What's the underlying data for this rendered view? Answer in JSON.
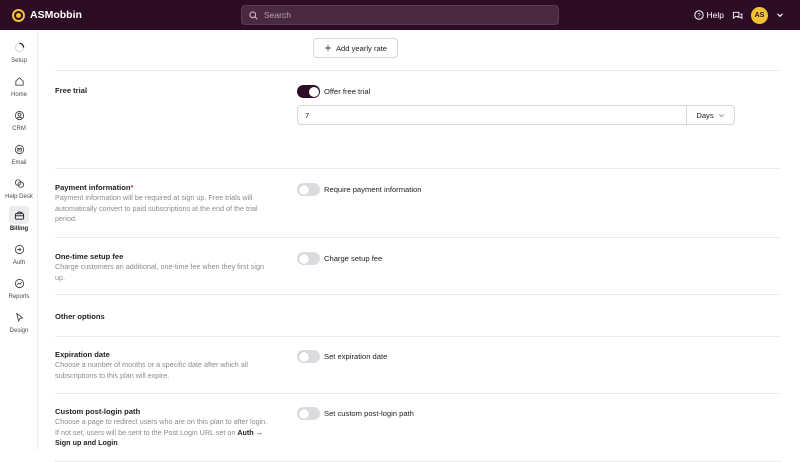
{
  "app": {
    "name": "ASMobbin"
  },
  "search": {
    "placeholder": "Search"
  },
  "header": {
    "help_label": "Help",
    "avatar_initials": "AS"
  },
  "nav": {
    "items": [
      {
        "label": "Setup",
        "icon": "progress-ring-icon"
      },
      {
        "label": "Home",
        "icon": "home-icon"
      },
      {
        "label": "CRM",
        "icon": "user-circle-icon"
      },
      {
        "label": "Email",
        "icon": "envelope-icon"
      },
      {
        "label": "Help Desk",
        "icon": "chat-bubbles-icon"
      },
      {
        "label": "Billing",
        "icon": "billing-icon",
        "active": true
      },
      {
        "label": "Auth",
        "icon": "login-icon"
      },
      {
        "label": "Reports",
        "icon": "chart-icon"
      },
      {
        "label": "Design",
        "icon": "cursor-icon"
      }
    ]
  },
  "yearly": {
    "add_label": "Add yearly rate"
  },
  "free_trial": {
    "title": "Free trial",
    "toggle_label": "Offer free trial",
    "enabled": true,
    "length_value": "7",
    "unit_value": "Days"
  },
  "payment_info": {
    "title": "Payment information",
    "required_mark": "*",
    "description": "Payment information will be required at sign up. Free trials will automatically convert to paid subscriptions at the end of the trial period.",
    "toggle_label": "Require payment information",
    "enabled": false
  },
  "setup_fee": {
    "title": "One-time setup fee",
    "description": "Charge customers an additional, one-time fee when they first sign up.",
    "toggle_label": "Charge setup fee",
    "enabled": false
  },
  "other_options": {
    "title": "Other options"
  },
  "expiration": {
    "title": "Expiration date",
    "description": "Choose a number of months or a specific date after which all subscriptions to this plan will expire.",
    "toggle_label": "Set expiration date",
    "enabled": false
  },
  "post_login": {
    "title": "Custom post-login path",
    "description_prefix": "Choose a page to redirect users who are on this plan to after login. If not set, users will be sent to the Post Login URL set on ",
    "description_link": "Auth → Sign up and Login",
    "description_suffix": ".",
    "toggle_label": "Set custom post-login path",
    "enabled": false
  },
  "colors": {
    "topbar": "#2d0d26",
    "accent": "#f2c233",
    "toggle_on": "#2d0d26"
  }
}
